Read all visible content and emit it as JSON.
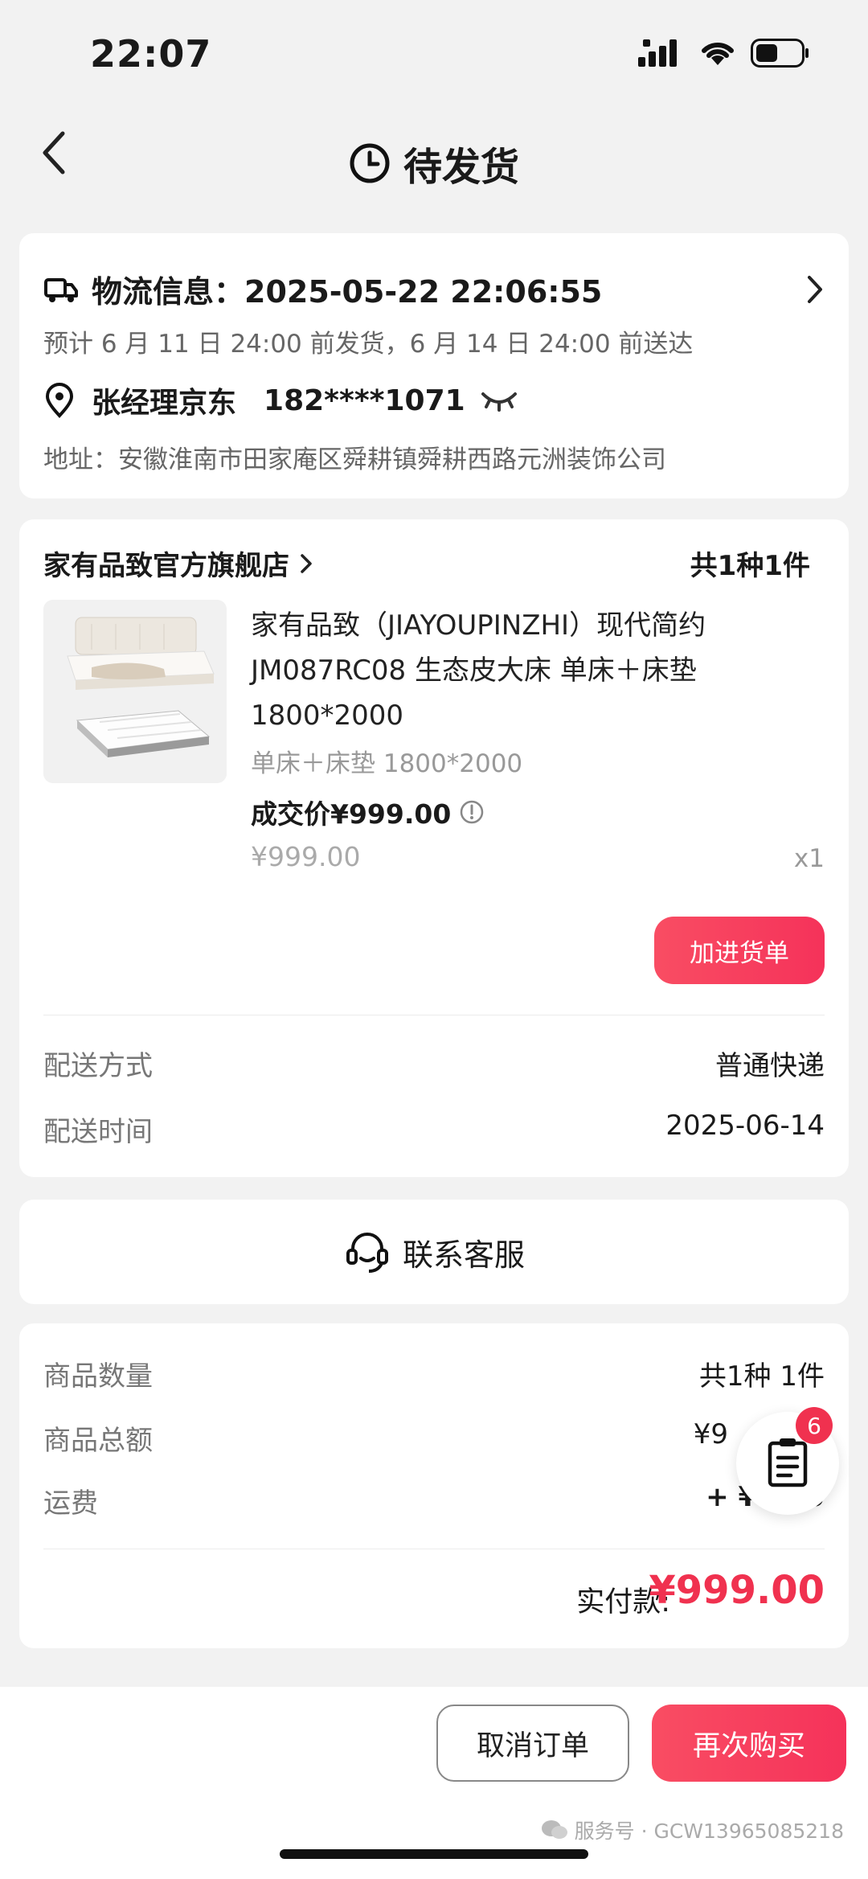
{
  "status_bar": {
    "time": "22:07"
  },
  "nav": {
    "title": "待发货"
  },
  "logistics": {
    "title": "物流信息：2025-05-22 22:06:55",
    "eta": "预计 6 月 11 日 24:00 前发货，6 月 14 日 24:00 前送达",
    "recipient": "张经理京东",
    "phone": "182****1071",
    "address": "地址：安徽淮南市田家庵区舜耕镇舜耕西路元洲装饰公司"
  },
  "order": {
    "store_name": "家有品致官方旗舰店",
    "item_count": "共1种1件",
    "product_title": "家有品致（JIAYOUPINZHI）现代简约 JM087RC08 生态皮大床 单床＋床垫 1800*2000",
    "product_spec": "单床＋床垫 1800*2000",
    "deal_price": "成交价¥999.00",
    "original_price": "¥999.00",
    "quantity": "x1",
    "add_button": "加进货单",
    "delivery_method_label": "配送方式",
    "delivery_method_value": "普通快递",
    "delivery_time_label": "配送时间",
    "delivery_time_value": "2025-06-14"
  },
  "service": {
    "label": "联系客服"
  },
  "summary": {
    "qty_label": "商品数量",
    "qty_value": "共1种 1件",
    "total_label": "商品总额",
    "total_value": "¥9",
    "freight_label": "运费",
    "freight_value": "+ ¥0.00",
    "paid_label": "实付款:",
    "paid_value": "¥999.00"
  },
  "float_badge": "6",
  "bottom": {
    "cancel": "取消订单",
    "rebuy": "再次购买",
    "watermark": "服务号 · GCW13965085218"
  },
  "colors": {
    "accent": "#f0314f",
    "button_gradient_start": "#f94d63"
  }
}
